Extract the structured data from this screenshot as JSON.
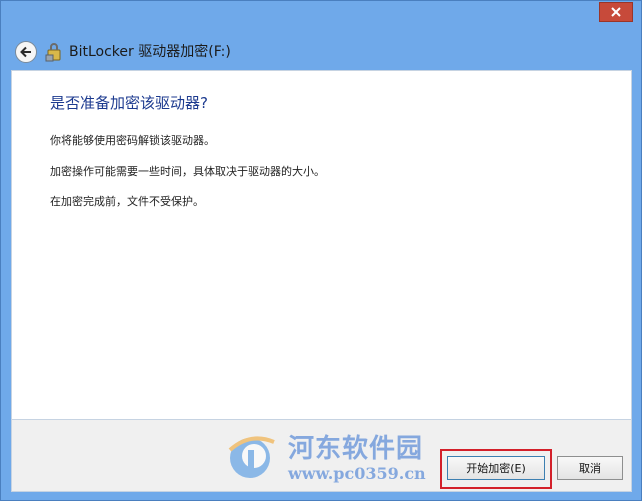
{
  "window": {
    "title": "BitLocker 驱动器加密(F:)",
    "close_glyph": "✕",
    "back_glyph": "←"
  },
  "content": {
    "heading": "是否准备加密该驱动器?",
    "paragraphs": [
      "你将能够使用密码解锁该驱动器。",
      "加密操作可能需要一些时间，具体取决于驱动器的大小。",
      "在加密完成前，文件不受保护。"
    ]
  },
  "footer": {
    "start_button": "开始加密(E)",
    "cancel_button": "取消"
  },
  "watermark": {
    "name": "河东软件园",
    "url": "www.pc0359.cn"
  },
  "colors": {
    "frame": "#6fa9ea",
    "heading": "#1c3a8f",
    "highlight": "#d3202a",
    "close": "#c74a3a"
  },
  "icons": [
    "close-icon",
    "back-arrow-icon",
    "bitlocker-icon"
  ]
}
